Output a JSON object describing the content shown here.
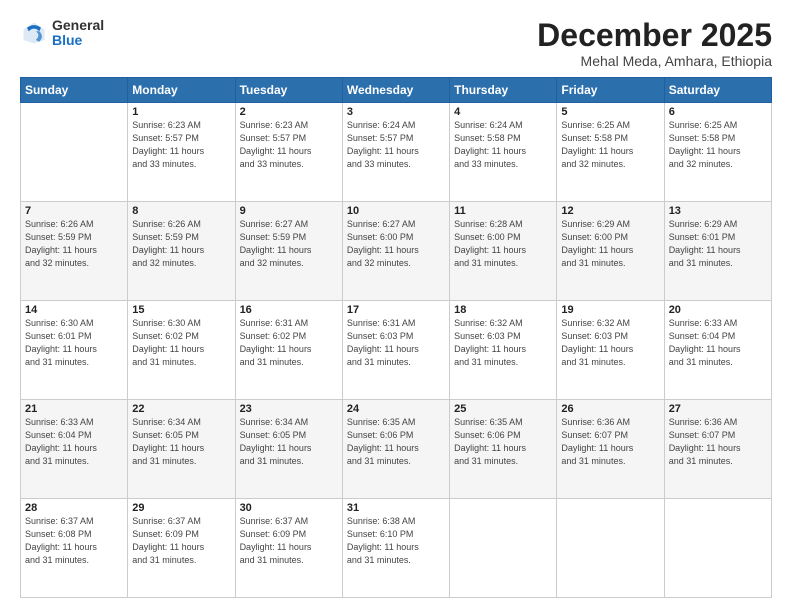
{
  "header": {
    "logo": {
      "general": "General",
      "blue": "Blue"
    },
    "title": "December 2025",
    "location": "Mehal Meda, Amhara, Ethiopia"
  },
  "calendar": {
    "days_of_week": [
      "Sunday",
      "Monday",
      "Tuesday",
      "Wednesday",
      "Thursday",
      "Friday",
      "Saturday"
    ],
    "weeks": [
      [
        {
          "day": "",
          "info": ""
        },
        {
          "day": "1",
          "info": "Sunrise: 6:23 AM\nSunset: 5:57 PM\nDaylight: 11 hours\nand 33 minutes."
        },
        {
          "day": "2",
          "info": "Sunrise: 6:23 AM\nSunset: 5:57 PM\nDaylight: 11 hours\nand 33 minutes."
        },
        {
          "day": "3",
          "info": "Sunrise: 6:24 AM\nSunset: 5:57 PM\nDaylight: 11 hours\nand 33 minutes."
        },
        {
          "day": "4",
          "info": "Sunrise: 6:24 AM\nSunset: 5:58 PM\nDaylight: 11 hours\nand 33 minutes."
        },
        {
          "day": "5",
          "info": "Sunrise: 6:25 AM\nSunset: 5:58 PM\nDaylight: 11 hours\nand 32 minutes."
        },
        {
          "day": "6",
          "info": "Sunrise: 6:25 AM\nSunset: 5:58 PM\nDaylight: 11 hours\nand 32 minutes."
        }
      ],
      [
        {
          "day": "7",
          "info": "Sunrise: 6:26 AM\nSunset: 5:59 PM\nDaylight: 11 hours\nand 32 minutes."
        },
        {
          "day": "8",
          "info": "Sunrise: 6:26 AM\nSunset: 5:59 PM\nDaylight: 11 hours\nand 32 minutes."
        },
        {
          "day": "9",
          "info": "Sunrise: 6:27 AM\nSunset: 5:59 PM\nDaylight: 11 hours\nand 32 minutes."
        },
        {
          "day": "10",
          "info": "Sunrise: 6:27 AM\nSunset: 6:00 PM\nDaylight: 11 hours\nand 32 minutes."
        },
        {
          "day": "11",
          "info": "Sunrise: 6:28 AM\nSunset: 6:00 PM\nDaylight: 11 hours\nand 31 minutes."
        },
        {
          "day": "12",
          "info": "Sunrise: 6:29 AM\nSunset: 6:00 PM\nDaylight: 11 hours\nand 31 minutes."
        },
        {
          "day": "13",
          "info": "Sunrise: 6:29 AM\nSunset: 6:01 PM\nDaylight: 11 hours\nand 31 minutes."
        }
      ],
      [
        {
          "day": "14",
          "info": "Sunrise: 6:30 AM\nSunset: 6:01 PM\nDaylight: 11 hours\nand 31 minutes."
        },
        {
          "day": "15",
          "info": "Sunrise: 6:30 AM\nSunset: 6:02 PM\nDaylight: 11 hours\nand 31 minutes."
        },
        {
          "day": "16",
          "info": "Sunrise: 6:31 AM\nSunset: 6:02 PM\nDaylight: 11 hours\nand 31 minutes."
        },
        {
          "day": "17",
          "info": "Sunrise: 6:31 AM\nSunset: 6:03 PM\nDaylight: 11 hours\nand 31 minutes."
        },
        {
          "day": "18",
          "info": "Sunrise: 6:32 AM\nSunset: 6:03 PM\nDaylight: 11 hours\nand 31 minutes."
        },
        {
          "day": "19",
          "info": "Sunrise: 6:32 AM\nSunset: 6:03 PM\nDaylight: 11 hours\nand 31 minutes."
        },
        {
          "day": "20",
          "info": "Sunrise: 6:33 AM\nSunset: 6:04 PM\nDaylight: 11 hours\nand 31 minutes."
        }
      ],
      [
        {
          "day": "21",
          "info": "Sunrise: 6:33 AM\nSunset: 6:04 PM\nDaylight: 11 hours\nand 31 minutes."
        },
        {
          "day": "22",
          "info": "Sunrise: 6:34 AM\nSunset: 6:05 PM\nDaylight: 11 hours\nand 31 minutes."
        },
        {
          "day": "23",
          "info": "Sunrise: 6:34 AM\nSunset: 6:05 PM\nDaylight: 11 hours\nand 31 minutes."
        },
        {
          "day": "24",
          "info": "Sunrise: 6:35 AM\nSunset: 6:06 PM\nDaylight: 11 hours\nand 31 minutes."
        },
        {
          "day": "25",
          "info": "Sunrise: 6:35 AM\nSunset: 6:06 PM\nDaylight: 11 hours\nand 31 minutes."
        },
        {
          "day": "26",
          "info": "Sunrise: 6:36 AM\nSunset: 6:07 PM\nDaylight: 11 hours\nand 31 minutes."
        },
        {
          "day": "27",
          "info": "Sunrise: 6:36 AM\nSunset: 6:07 PM\nDaylight: 11 hours\nand 31 minutes."
        }
      ],
      [
        {
          "day": "28",
          "info": "Sunrise: 6:37 AM\nSunset: 6:08 PM\nDaylight: 11 hours\nand 31 minutes."
        },
        {
          "day": "29",
          "info": "Sunrise: 6:37 AM\nSunset: 6:09 PM\nDaylight: 11 hours\nand 31 minutes."
        },
        {
          "day": "30",
          "info": "Sunrise: 6:37 AM\nSunset: 6:09 PM\nDaylight: 11 hours\nand 31 minutes."
        },
        {
          "day": "31",
          "info": "Sunrise: 6:38 AM\nSunset: 6:10 PM\nDaylight: 11 hours\nand 31 minutes."
        },
        {
          "day": "",
          "info": ""
        },
        {
          "day": "",
          "info": ""
        },
        {
          "day": "",
          "info": ""
        }
      ]
    ]
  }
}
